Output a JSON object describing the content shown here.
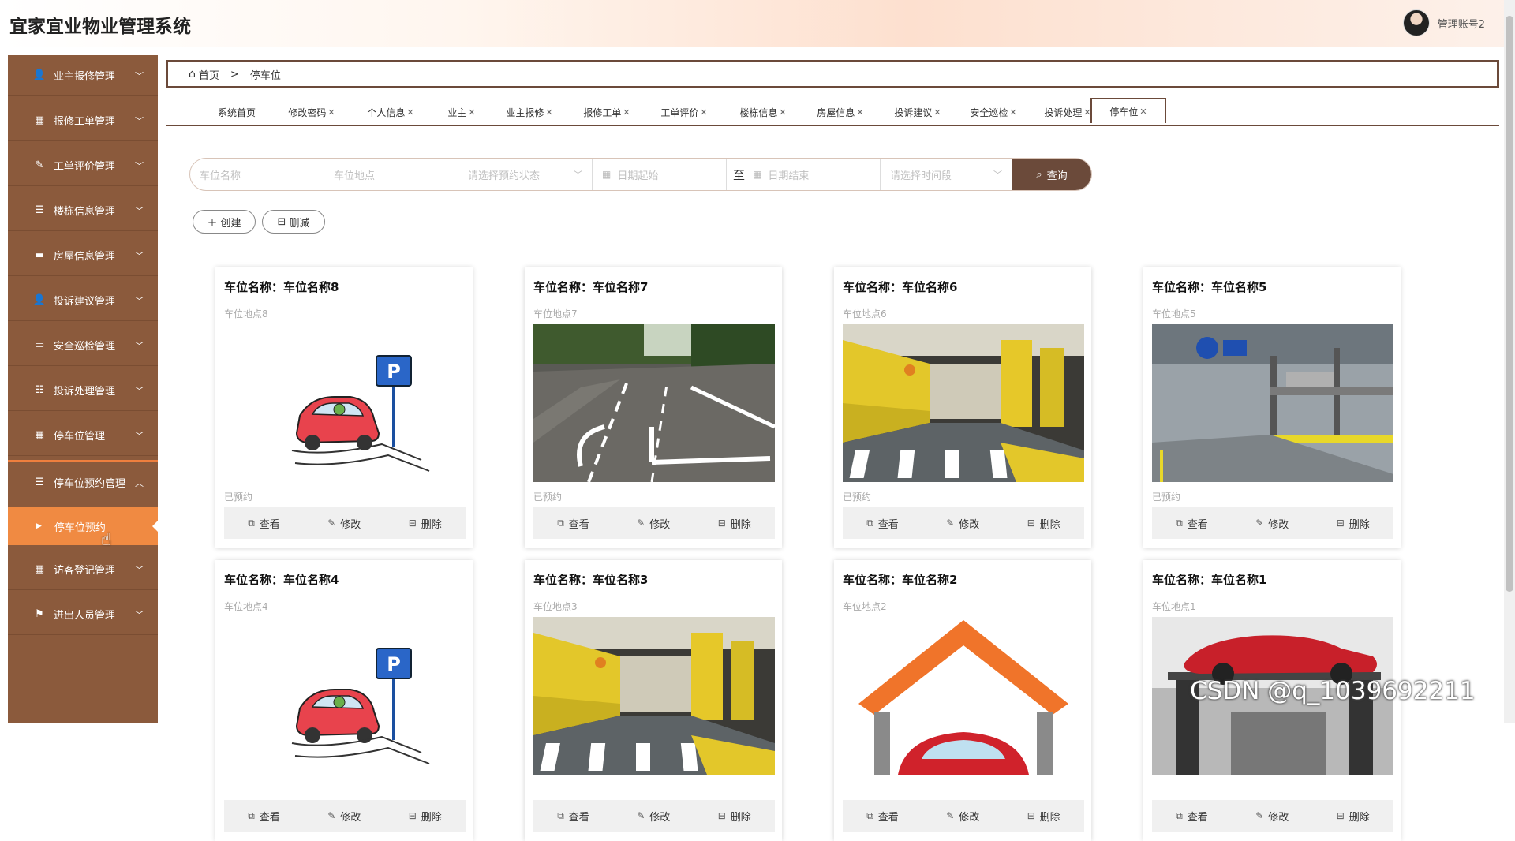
{
  "header": {
    "title": "宜家宜业物业管理系统",
    "user_name": "管理账号2"
  },
  "sidebar": {
    "items": [
      {
        "label": "业主报修管理",
        "icon": "user-icon"
      },
      {
        "label": "报修工单管理",
        "icon": "grid-icon"
      },
      {
        "label": "工单评价管理",
        "icon": "edit-icon"
      },
      {
        "label": "楼栋信息管理",
        "icon": "list-icon"
      },
      {
        "label": "房屋信息管理",
        "icon": "ticket-icon"
      },
      {
        "label": "投诉建议管理",
        "icon": "user-icon"
      },
      {
        "label": "安全巡检管理",
        "icon": "monitor-icon"
      },
      {
        "label": "投诉处理管理",
        "icon": "sliders-icon"
      },
      {
        "label": "停车位管理",
        "icon": "grid-icon"
      },
      {
        "label": "停车位预约管理",
        "icon": "list-icon"
      },
      {
        "label": "访客登记管理",
        "icon": "grid-icon"
      },
      {
        "label": "进出人员管理",
        "icon": "flag-icon"
      }
    ],
    "sub_item": "停车位预约"
  },
  "breadcrumb": {
    "home": "首页",
    "separator": ">",
    "current": "停车位"
  },
  "tabs": [
    {
      "label": "系统首页",
      "closable": false
    },
    {
      "label": "修改密码",
      "closable": true
    },
    {
      "label": "个人信息",
      "closable": true
    },
    {
      "label": "业主",
      "closable": true
    },
    {
      "label": "业主报修",
      "closable": true
    },
    {
      "label": "报修工单",
      "closable": true
    },
    {
      "label": "工单评价",
      "closable": true
    },
    {
      "label": "楼栋信息",
      "closable": true
    },
    {
      "label": "房屋信息",
      "closable": true
    },
    {
      "label": "投诉建议",
      "closable": true
    },
    {
      "label": "安全巡检",
      "closable": true
    },
    {
      "label": "投诉处理",
      "closable": true
    },
    {
      "label": "停车位",
      "closable": true,
      "active": true
    }
  ],
  "search": {
    "name_placeholder": "车位名称",
    "location_placeholder": "车位地点",
    "status_placeholder": "请选择预约状态",
    "date_start_placeholder": "日期起始",
    "date_sep": "至",
    "date_end_placeholder": "日期结束",
    "time_placeholder": "请选择时间段",
    "button": "查询"
  },
  "actions": {
    "create": "创建",
    "delete": "删减"
  },
  "card_labels": {
    "name_prefix": "车位名称：",
    "view": "查看",
    "edit": "修改",
    "delete": "删除"
  },
  "cards": [
    {
      "name": "车位名称8",
      "location": "车位地点8",
      "status": "已预约",
      "image": "cartoon-parking"
    },
    {
      "name": "车位名称7",
      "location": "车位地点7",
      "status": "已预约",
      "image": "outdoor-lot"
    },
    {
      "name": "车位名称6",
      "location": "车位地点6",
      "status": "已预约",
      "image": "garage-yellow"
    },
    {
      "name": "车位名称5",
      "location": "车位地点5",
      "status": "已预约",
      "image": "lift-garage"
    },
    {
      "name": "车位名称4",
      "location": "车位地点4",
      "status": "",
      "image": "cartoon-parking"
    },
    {
      "name": "车位名称3",
      "location": "车位地点3",
      "status": "",
      "image": "garage-yellow"
    },
    {
      "name": "车位名称2",
      "location": "车位地点2",
      "status": "",
      "image": "car-house"
    },
    {
      "name": "车位名称1",
      "location": "车位地点1",
      "status": "",
      "image": "red-car-lift"
    }
  ],
  "watermark": "CSDN @q_1039692211",
  "colors": {
    "sidebar": "#8b5a3c",
    "accent": "#f08a42",
    "dark": "#6b4a3a"
  }
}
